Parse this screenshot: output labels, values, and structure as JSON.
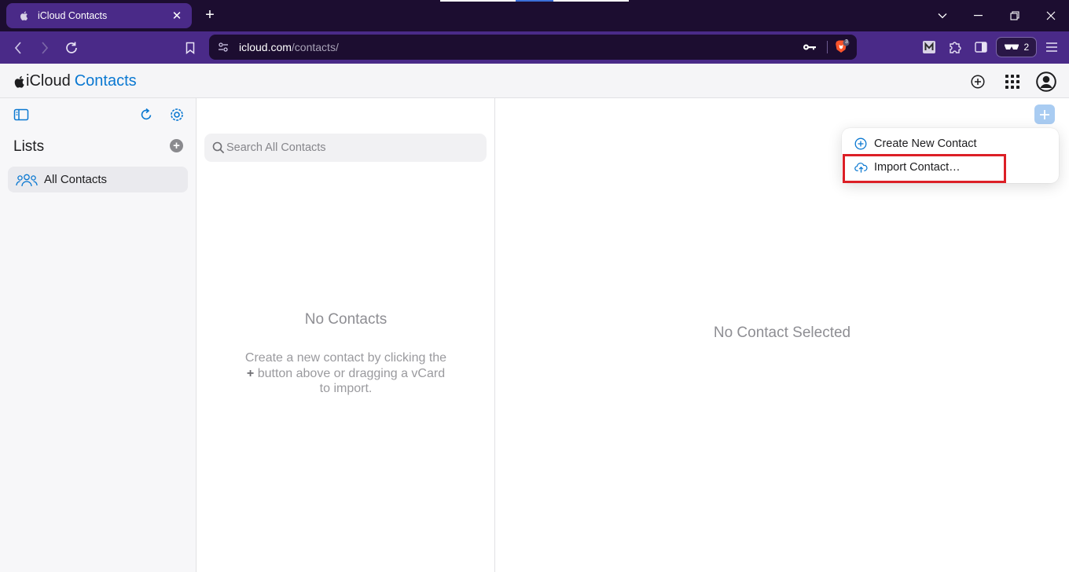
{
  "browser": {
    "tab": {
      "title": "iCloud Contacts"
    },
    "omnibox": {
      "domain": "icloud.com",
      "path": "/contacts/"
    },
    "brave_badge_count": "3",
    "wallet_count": "2",
    "colors": {
      "tabbar": "#1c0d30",
      "toolbar": "#4a2a88"
    }
  },
  "app": {
    "brand": {
      "icloud": "iCloud",
      "app_name": "Contacts"
    },
    "accent_color": "#0a78d1"
  },
  "sidebar": {
    "lists_title": "Lists",
    "items": [
      {
        "label": "All Contacts",
        "icon": "people-group-icon",
        "selected": true
      }
    ]
  },
  "contact_list": {
    "search_placeholder": "Search All Contacts",
    "empty_title": "No Contacts",
    "empty_body_1": "Create a new contact by clicking the",
    "empty_body_plus": "+",
    "empty_body_2": "button above or dragging a vCard to import."
  },
  "detail": {
    "empty_text": "No Contact Selected"
  },
  "add_menu": {
    "items": [
      {
        "label": "Create New Contact",
        "icon": "plus-circle-icon"
      },
      {
        "label": "Import Contact…",
        "icon": "cloud-upload-icon",
        "highlighted": true
      }
    ],
    "highlight_color": "#dc1f26"
  }
}
